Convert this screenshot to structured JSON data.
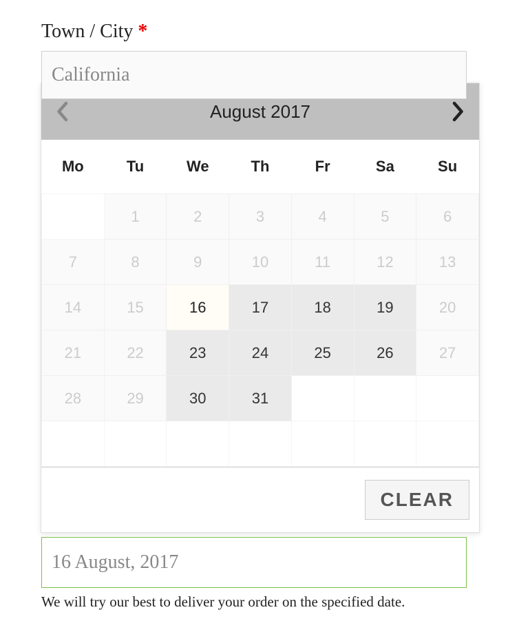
{
  "form": {
    "town_city_label": "Town / City",
    "required_mark": "*",
    "town_city_value": "California",
    "date_selected_display": "16 August, 2017",
    "help_text": "We will try our best to deliver your order on the specified date."
  },
  "datepicker": {
    "month_title": "August 2017",
    "clear_label": "CLEAR",
    "weekdays": [
      "Mo",
      "Tu",
      "We",
      "Th",
      "Fr",
      "Sa",
      "Su"
    ],
    "rows": [
      [
        {
          "label": "",
          "state": "empty"
        },
        {
          "label": "1",
          "state": "disabled"
        },
        {
          "label": "2",
          "state": "disabled"
        },
        {
          "label": "3",
          "state": "disabled"
        },
        {
          "label": "4",
          "state": "disabled"
        },
        {
          "label": "5",
          "state": "disabled"
        },
        {
          "label": "6",
          "state": "disabled"
        }
      ],
      [
        {
          "label": "7",
          "state": "disabled"
        },
        {
          "label": "8",
          "state": "disabled"
        },
        {
          "label": "9",
          "state": "disabled"
        },
        {
          "label": "10",
          "state": "disabled"
        },
        {
          "label": "11",
          "state": "disabled"
        },
        {
          "label": "12",
          "state": "disabled"
        },
        {
          "label": "13",
          "state": "disabled"
        }
      ],
      [
        {
          "label": "14",
          "state": "disabled"
        },
        {
          "label": "15",
          "state": "disabled"
        },
        {
          "label": "16",
          "state": "selected"
        },
        {
          "label": "17",
          "state": "enabled"
        },
        {
          "label": "18",
          "state": "enabled"
        },
        {
          "label": "19",
          "state": "enabled"
        },
        {
          "label": "20",
          "state": "disabled"
        }
      ],
      [
        {
          "label": "21",
          "state": "disabled"
        },
        {
          "label": "22",
          "state": "disabled"
        },
        {
          "label": "23",
          "state": "enabled"
        },
        {
          "label": "24",
          "state": "enabled"
        },
        {
          "label": "25",
          "state": "enabled"
        },
        {
          "label": "26",
          "state": "enabled"
        },
        {
          "label": "27",
          "state": "disabled"
        }
      ],
      [
        {
          "label": "28",
          "state": "disabled"
        },
        {
          "label": "29",
          "state": "disabled"
        },
        {
          "label": "30",
          "state": "enabled"
        },
        {
          "label": "31",
          "state": "enabled"
        },
        {
          "label": "",
          "state": "empty"
        },
        {
          "label": "",
          "state": "empty"
        },
        {
          "label": "",
          "state": "empty"
        }
      ],
      [
        {
          "label": "",
          "state": "empty"
        },
        {
          "label": "",
          "state": "empty"
        },
        {
          "label": "",
          "state": "empty"
        },
        {
          "label": "",
          "state": "empty"
        },
        {
          "label": "",
          "state": "empty"
        },
        {
          "label": "",
          "state": "empty"
        },
        {
          "label": "",
          "state": "empty"
        }
      ]
    ]
  }
}
